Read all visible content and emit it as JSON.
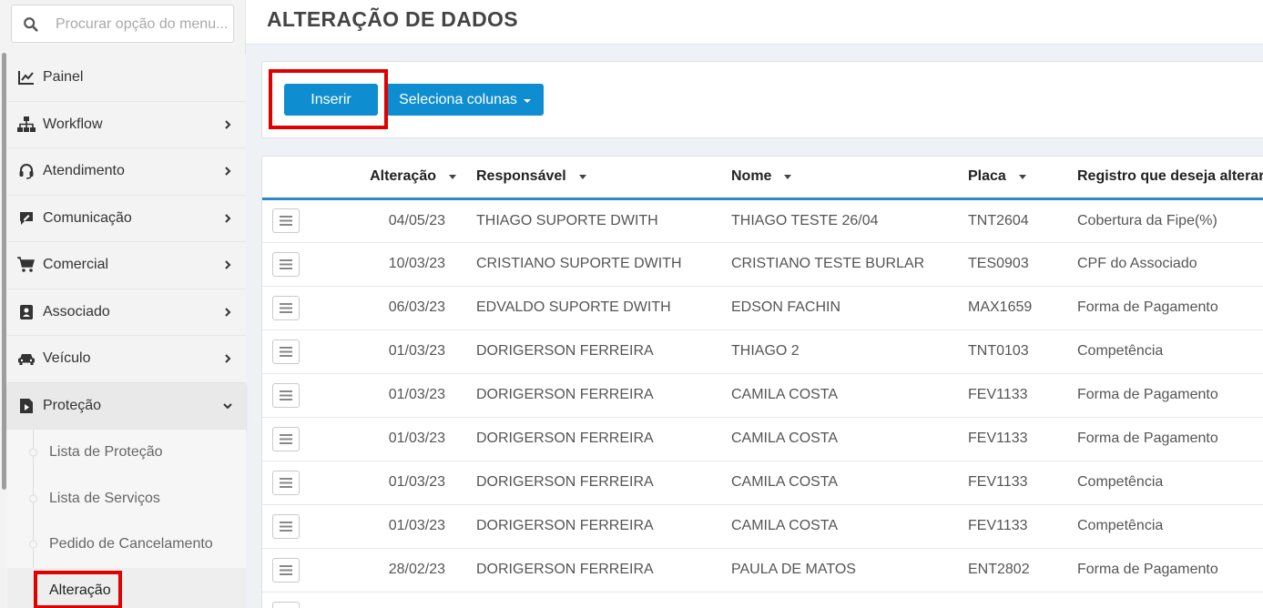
{
  "search": {
    "placeholder": "Procurar opção do menu..."
  },
  "sidebar": {
    "items": [
      {
        "label": "Painel",
        "icon": "chart-line-icon"
      },
      {
        "label": "Workflow",
        "icon": "sitemap-icon"
      },
      {
        "label": "Atendimento",
        "icon": "headset-icon"
      },
      {
        "label": "Comunicação",
        "icon": "comment-edit-icon"
      },
      {
        "label": "Comercial",
        "icon": "cart-icon"
      },
      {
        "label": "Associado",
        "icon": "id-card-icon"
      },
      {
        "label": "Veículo",
        "icon": "car-icon"
      },
      {
        "label": "Proteção",
        "icon": "file-play-icon"
      }
    ],
    "submenu": [
      {
        "label": "Lista de Proteção"
      },
      {
        "label": "Lista de Serviços"
      },
      {
        "label": "Pedido de Cancelamento"
      },
      {
        "label": "Alteração"
      }
    ]
  },
  "header": {
    "title": "ALTERAÇÃO DE DADOS"
  },
  "toolbar": {
    "insert_label": "Inserir",
    "columns_label": "Seleciona colunas"
  },
  "table": {
    "columns": [
      "Alteração",
      "Responsável",
      "Nome",
      "Placa",
      "Registro que deseja alterar"
    ],
    "rows": [
      {
        "date": "04/05/23",
        "responsible": "THIAGO SUPORTE DWITH",
        "name": "THIAGO TESTE 26/04",
        "plate": "TNT2604",
        "record": "Cobertura da Fipe(%)"
      },
      {
        "date": "10/03/23",
        "responsible": "CRISTIANO SUPORTE DWITH",
        "name": "CRISTIANO TESTE BURLAR",
        "plate": "TES0903",
        "record": "CPF do Associado"
      },
      {
        "date": "06/03/23",
        "responsible": "EDVALDO SUPORTE DWITH",
        "name": "EDSON FACHIN",
        "plate": "MAX1659",
        "record": "Forma de Pagamento"
      },
      {
        "date": "01/03/23",
        "responsible": "DORIGERSON FERREIRA",
        "name": "THIAGO 2",
        "plate": "TNT0103",
        "record": "Competência"
      },
      {
        "date": "01/03/23",
        "responsible": "DORIGERSON FERREIRA",
        "name": "CAMILA COSTA",
        "plate": "FEV1133",
        "record": "Forma de Pagamento"
      },
      {
        "date": "01/03/23",
        "responsible": "DORIGERSON FERREIRA",
        "name": "CAMILA COSTA",
        "plate": "FEV1133",
        "record": "Forma de Pagamento"
      },
      {
        "date": "01/03/23",
        "responsible": "DORIGERSON FERREIRA",
        "name": "CAMILA COSTA",
        "plate": "FEV1133",
        "record": "Competência"
      },
      {
        "date": "01/03/23",
        "responsible": "DORIGERSON FERREIRA",
        "name": "CAMILA COSTA",
        "plate": "FEV1133",
        "record": "Competência"
      },
      {
        "date": "28/02/23",
        "responsible": "DORIGERSON FERREIRA",
        "name": "PAULA DE MATOS",
        "plate": "ENT2802",
        "record": "Forma de Pagamento"
      },
      {
        "date": "",
        "responsible": "",
        "name": "",
        "plate": "",
        "record": ""
      }
    ]
  },
  "colors": {
    "primary": "#0e8ed1",
    "highlight": "#e00000",
    "header_rule": "#2a88c8"
  }
}
